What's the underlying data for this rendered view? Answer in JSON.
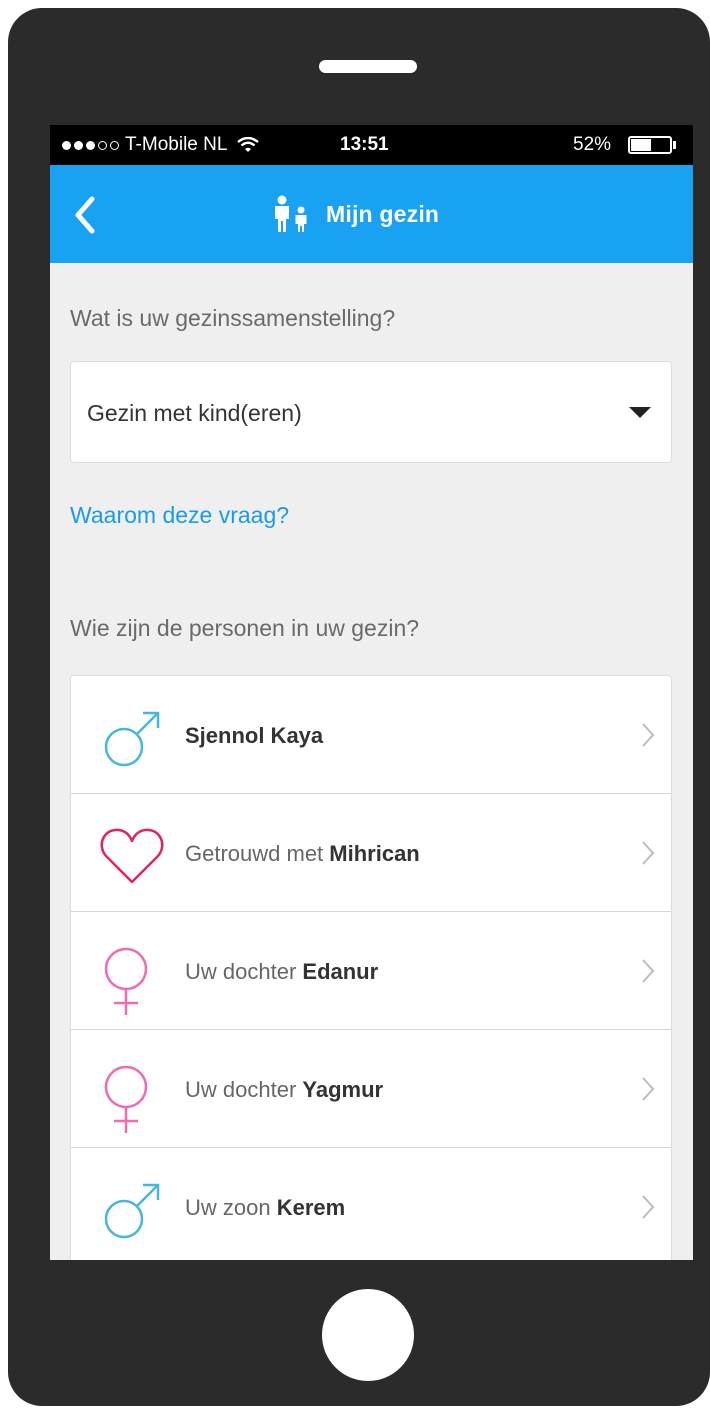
{
  "status_bar": {
    "carrier": "T-Mobile NL",
    "time": "13:51",
    "battery": "52%",
    "battery_level": 0.52,
    "signal_bars_filled": 3,
    "signal_bars_total": 5
  },
  "navbar": {
    "title": "Mijn gezin",
    "back_icon": "chevron-left-icon",
    "title_icon": "family-icon"
  },
  "household_question": "Wat is uw gezinssamenstelling?",
  "household_select": {
    "value": "Gezin met kind(eren)"
  },
  "why_link": "Waarom deze vraag?",
  "members_question": "Wie zijn de personen in uw gezin?",
  "members": [
    {
      "prefix": "",
      "name": "Sjennol Kaya",
      "icon": "male-symbol-icon"
    },
    {
      "prefix": "Getrouwd met ",
      "name": "Mihrican",
      "icon": "heart-icon"
    },
    {
      "prefix": "Uw dochter ",
      "name": "Edanur",
      "icon": "female-symbol-icon"
    },
    {
      "prefix": "Uw dochter ",
      "name": "Yagmur",
      "icon": "female-symbol-icon"
    },
    {
      "prefix": "Uw zoon ",
      "name": "Kerem",
      "icon": "male-symbol-icon"
    }
  ],
  "colors": {
    "navbar": "#1aa2f2",
    "link": "#1a9be8",
    "male": "#44b8dc",
    "female": "#f06ab0",
    "heart": "#e0245e"
  }
}
